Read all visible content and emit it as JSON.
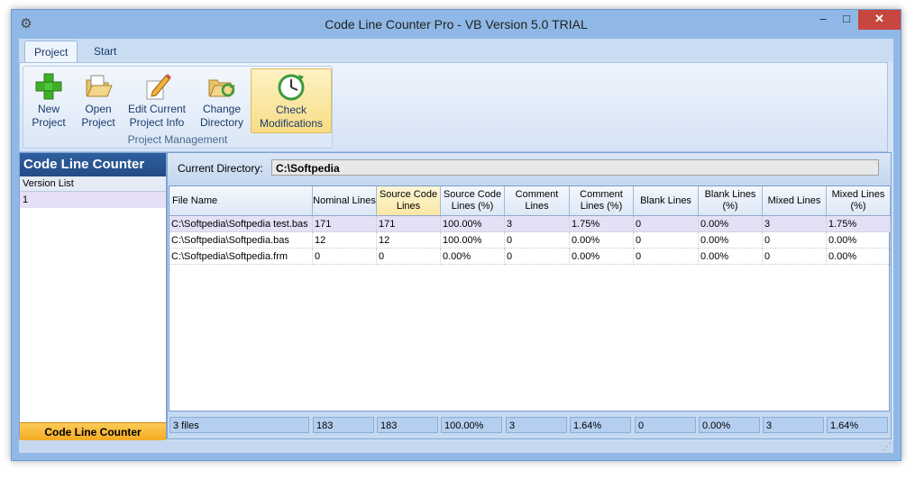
{
  "window": {
    "title": "Code Line Counter Pro - VB Version 5.0 TRIAL",
    "icon": "gear-icon",
    "controls": {
      "minimize": "–",
      "maximize": "□",
      "close": "✕"
    }
  },
  "ribbon": {
    "tabs": [
      {
        "label": "Project",
        "active": true
      },
      {
        "label": "Start",
        "active": false
      }
    ],
    "group_label": "Project Management",
    "buttons": [
      {
        "line1": "New",
        "line2": "Project",
        "icon": "plus-icon"
      },
      {
        "line1": "Open",
        "line2": "Project",
        "icon": "open-folder-icon"
      },
      {
        "line1": "Edit Current",
        "line2": "Project Info",
        "icon": "pencil-icon"
      },
      {
        "line1": "Change",
        "line2": "Directory",
        "icon": "folder-refresh-icon"
      },
      {
        "line1": "Check",
        "line2": "Modifications",
        "icon": "clock-icon"
      }
    ]
  },
  "left_panel": {
    "title": "Code Line Counter",
    "header": "Version List",
    "items": [
      "1"
    ],
    "footer": "Code Line Counter"
  },
  "directory": {
    "label": "Current Directory:",
    "value": "C:\\Softpedia"
  },
  "grid": {
    "columns": [
      "File Name",
      "Nominal Lines",
      "Source Code Lines",
      "Source Code Lines (%)",
      "Comment Lines",
      "Comment Lines (%)",
      "Blank Lines",
      "Blank Lines (%)",
      "Mixed Lines",
      "Mixed Lines (%)"
    ],
    "rows": [
      [
        "C:\\Softpedia\\Softpedia test.bas",
        "171",
        "171",
        "100.00%",
        "3",
        "1.75%",
        "0",
        "0.00%",
        "3",
        "1.75%"
      ],
      [
        "C:\\Softpedia\\Softpedia.bas",
        "12",
        "12",
        "100.00%",
        "0",
        "0.00%",
        "0",
        "0.00%",
        "0",
        "0.00%"
      ],
      [
        "C:\\Softpedia\\Softpedia.frm",
        "0",
        "0",
        "0.00%",
        "0",
        "0.00%",
        "0",
        "0.00%",
        "0",
        "0.00%"
      ]
    ],
    "totals": [
      "3 files",
      "183",
      "183",
      "100.00%",
      "3",
      "1.64%",
      "0",
      "0.00%",
      "3",
      "1.64%"
    ]
  },
  "colors": {
    "accent": "#2f5f9e",
    "footer": "#f5a920",
    "selection": "#e6e0f6"
  }
}
